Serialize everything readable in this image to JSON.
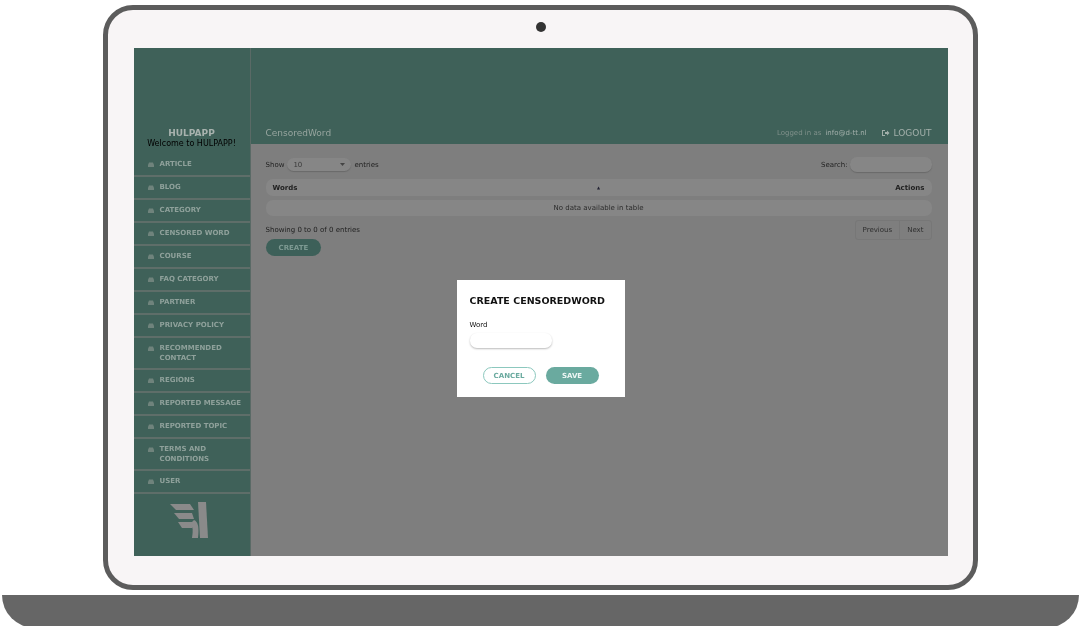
{
  "sidebar": {
    "title": "HULPAPP",
    "subtitle": "Welcome to HULPAPP!",
    "items": [
      {
        "label": "ARTICLE"
      },
      {
        "label": "BLOG"
      },
      {
        "label": "CATEGORY"
      },
      {
        "label": "CENSORED WORD"
      },
      {
        "label": "COURSE"
      },
      {
        "label": "FAQ CATEGORY"
      },
      {
        "label": "PARTNER"
      },
      {
        "label": "PRIVACY POLICY"
      },
      {
        "label": "RECOMMENDED CONTACT"
      },
      {
        "label": "REGIONS"
      },
      {
        "label": "REPORTED MESSAGE"
      },
      {
        "label": "REPORTED TOPIC"
      },
      {
        "label": "TERMS AND CONDITIONS"
      },
      {
        "label": "USER"
      }
    ]
  },
  "header": {
    "page_title": "CensoredWord",
    "logged_in_label": "Logged in as",
    "user_email": "info@d-tt.nl",
    "logout": "LOGOUT"
  },
  "table_controls": {
    "show_label": "Show",
    "page_size": "10",
    "entries_label": "entries",
    "search_label": "Search:"
  },
  "table": {
    "columns": [
      "Words",
      "Actions"
    ],
    "sort_indicator": "▲",
    "empty_message": "No data available in table"
  },
  "info": "Showing 0 to 0 of 0 entries",
  "pagination": [
    "Previous",
    "Next"
  ],
  "create_button": "CREATE",
  "modal": {
    "title": "CREATE CENSOREDWORD",
    "field_label": "Word",
    "buttons": [
      {
        "label": "CANCEL",
        "kind": "secondary"
      },
      {
        "label": "SAVE",
        "kind": "primary"
      }
    ]
  }
}
